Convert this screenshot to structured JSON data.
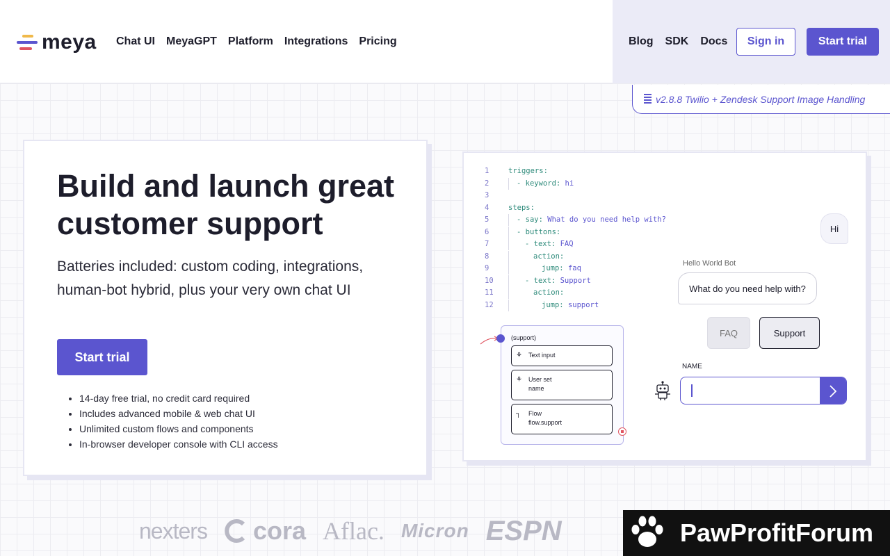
{
  "brand": {
    "name": "meya",
    "colors": {
      "accent": "#5b55cf",
      "bar_red": "#e05561",
      "bar_yellow": "#f0b94a",
      "bar_blue": "#5b55cf"
    }
  },
  "nav": {
    "main": [
      "Chat UI",
      "MeyaGPT",
      "Platform",
      "Integrations",
      "Pricing"
    ],
    "aux": [
      "Blog",
      "SDK",
      "Docs"
    ],
    "signin": "Sign in",
    "start_trial": "Start trial"
  },
  "release": {
    "icon": "document-icon",
    "text": "v2.8.8 Twilio + Zendesk Support Image Handling"
  },
  "hero": {
    "title": "Build and launch great customer support",
    "lead": "Batteries included: custom coding, integrations, human-bot hybrid, plus your very own chat UI",
    "cta": "Start trial",
    "bullets": [
      "14-day free trial, no credit card required",
      "Includes advanced mobile & web chat UI",
      "Unlimited custom flows and components",
      "In-browser developer console with CLI access"
    ]
  },
  "demo": {
    "code": [
      {
        "n": "1",
        "indent": 0,
        "k": "triggers:",
        "v": ""
      },
      {
        "n": "2",
        "indent": 1,
        "k": "- keyword:",
        "v": "hi"
      },
      {
        "n": "3",
        "indent": 0,
        "k": "",
        "v": ""
      },
      {
        "n": "4",
        "indent": 0,
        "k": "steps:",
        "v": ""
      },
      {
        "n": "5",
        "indent": 1,
        "k": "- say:",
        "v": " What do you need help with?"
      },
      {
        "n": "6",
        "indent": 1,
        "k": "- buttons:",
        "v": ""
      },
      {
        "n": "7",
        "indent": 2,
        "k": "- text:",
        "v": "FAQ"
      },
      {
        "n": "8",
        "indent": 3,
        "k": "action:",
        "v": ""
      },
      {
        "n": "9",
        "indent": 4,
        "k": "jump:",
        "v": "faq"
      },
      {
        "n": "10",
        "indent": 2,
        "k": "- text:",
        "v": "Support"
      },
      {
        "n": "11",
        "indent": 3,
        "k": "action:",
        "v": ""
      },
      {
        "n": "12",
        "indent": 4,
        "k": "jump:",
        "v": "support"
      }
    ],
    "flow": {
      "title": "(support)",
      "nodes": [
        {
          "icon": "component-icon",
          "label": "Text input",
          "sub": ""
        },
        {
          "icon": "component-icon",
          "label": "User set",
          "sub": "name"
        },
        {
          "icon": "flow-icon",
          "label": "Flow",
          "sub": "flow.support"
        }
      ]
    },
    "chat": {
      "user_msg": "Hi",
      "bot_name": "Hello World Bot",
      "bot_msg": "What do you need help with?",
      "quick_replies": [
        "FAQ",
        "Support"
      ],
      "input_label": "NAME",
      "input_value": ""
    }
  },
  "customers": [
    "nexters",
    "cora",
    "Aflac.",
    "Micron",
    "ESPN"
  ],
  "watermark": {
    "text": "PawProfitForum",
    "icon": "paw-icon"
  }
}
